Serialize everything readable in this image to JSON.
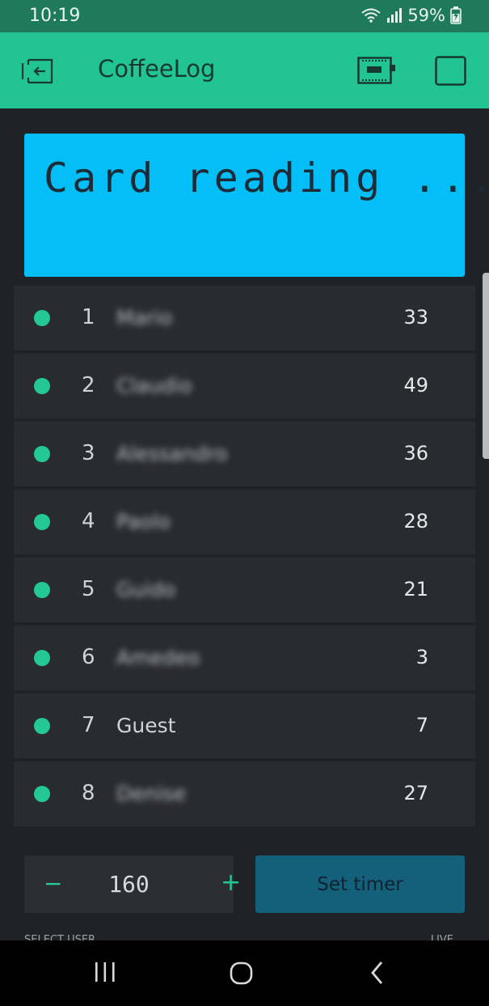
{
  "status_bar": {
    "time": "10:19",
    "battery": "59%",
    "icons": [
      "wifi-icon",
      "signal-icon",
      "battery-charging-icon"
    ]
  },
  "app_bar": {
    "title": "CoffeeLog",
    "icons": [
      "exit-project-icon",
      "device-icon",
      "stop-square-icon"
    ],
    "background": "#22c493"
  },
  "lcd": {
    "line1": "Card reading ...",
    "line2": "",
    "background": "#04bff7"
  },
  "table": {
    "rows": [
      {
        "index": "1",
        "name": "Mario",
        "value": "33",
        "name_blurred": true
      },
      {
        "index": "2",
        "name": "Claudio",
        "value": "49",
        "name_blurred": true
      },
      {
        "index": "3",
        "name": "Alessandro",
        "value": "36",
        "name_blurred": true
      },
      {
        "index": "4",
        "name": "Paolo",
        "value": "28",
        "name_blurred": true
      },
      {
        "index": "5",
        "name": "Guido",
        "value": "21",
        "name_blurred": true
      },
      {
        "index": "6",
        "name": "Amedeo",
        "value": "3",
        "name_blurred": true
      },
      {
        "index": "7",
        "name": "Guest",
        "value": "7",
        "name_blurred": false
      },
      {
        "index": "8",
        "name": "Denise",
        "value": "27",
        "name_blurred": true
      }
    ],
    "dot_color": "#23c893"
  },
  "stepper": {
    "minus": "−",
    "value": "160",
    "plus": "+"
  },
  "set_timer": {
    "label": "Set timer",
    "background": "#14607a"
  },
  "partial_labels": {
    "left": "SELECT USER",
    "right": "LIVE"
  },
  "nav_bar": {
    "icons": [
      "recent-apps-icon",
      "home-icon",
      "back-icon"
    ]
  }
}
